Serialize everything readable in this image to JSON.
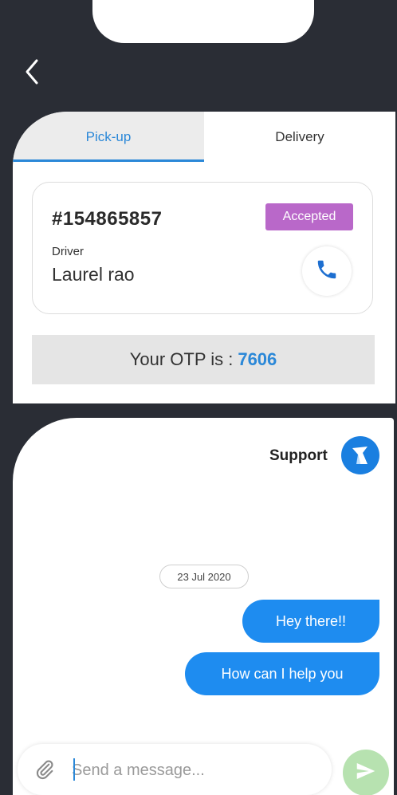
{
  "tabs": [
    {
      "label": "Pick-up",
      "active": true
    },
    {
      "label": "Delivery",
      "active": false
    }
  ],
  "order": {
    "id": "#154865857",
    "status": "Accepted",
    "driver_label": "Driver",
    "driver_name": "Laurel rao"
  },
  "otp": {
    "prefix": "Your OTP is :",
    "value": "7606"
  },
  "chat": {
    "support_label": "Support",
    "date": "23 Jul 2020",
    "messages": [
      {
        "text": "Hey there!!"
      },
      {
        "text": "How can I help you"
      }
    ]
  },
  "composer": {
    "placeholder": "Send a message..."
  },
  "icons": {
    "back": "chevron-left-icon",
    "call": "phone-icon",
    "avatar": "support-logo-icon",
    "attach": "paperclip-icon",
    "send": "send-arrow-icon"
  },
  "colors": {
    "accent": "#2b88d8",
    "badge": "#b968c9",
    "bubble": "#1e8cf0",
    "send": "#b7e2b0",
    "background": "#2a2d35"
  }
}
